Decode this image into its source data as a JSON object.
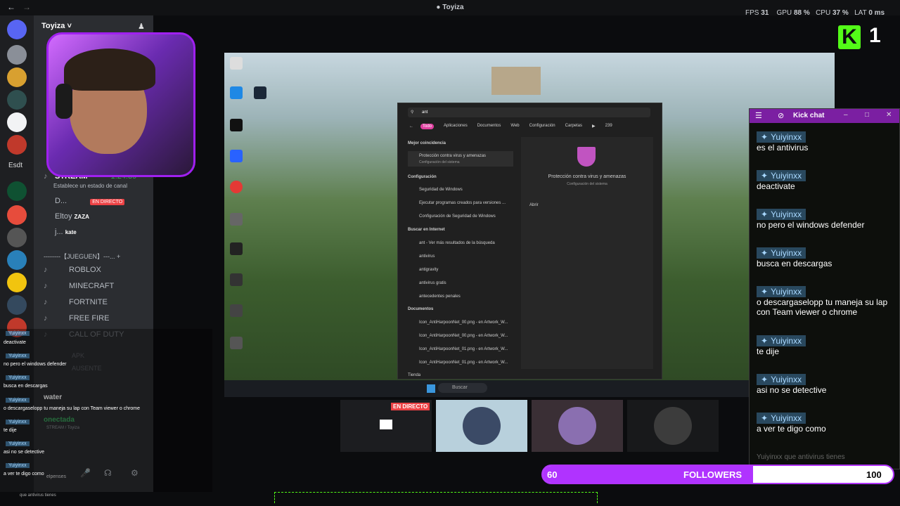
{
  "topbar": {
    "title": "Toyiza",
    "fps_label": "FPS",
    "fps": "31",
    "gpu_label": "GPU",
    "gpu": "88 %",
    "cpu_label": "CPU",
    "cpu": "37 %",
    "lat_label": "LAT",
    "lat": "0 ms"
  },
  "kick_logo": {
    "letter": "K",
    "count": "1"
  },
  "discord": {
    "server_name": "Toyiza",
    "rail_label": "Esdt",
    "channels": [
      {
        "name": "STREAM",
        "time": "1:24:39",
        "status": "Establece un estado de canal"
      },
      {
        "name": "D...",
        "badge": "EN DIRECTO"
      },
      {
        "name": "Eltoy",
        "extra": "ZAZA"
      },
      {
        "name": "j...",
        "extra": "kate"
      }
    ],
    "category": "--------【JUEGUEN】---...",
    "voice": [
      "ROBLOX",
      "MINECRAFT",
      "FORTNITE",
      "FREE FIRE",
      "CALL OF DUTY",
      "APK",
      "AUSENTE"
    ],
    "user": "water",
    "conn": "onectada",
    "conn_sub": "STREAM / Toyiza"
  },
  "start_menu": {
    "search": "ant",
    "tabs": [
      "Todo",
      "Aplicaciones",
      "Documentos",
      "Web",
      "Configuración",
      "Carpetas"
    ],
    "count": "239",
    "best_match_header": "Mejor coincidencia",
    "best_match": "Protección contra virus y amenazas",
    "best_match_sub": "Configuración del sistema",
    "config_header": "Configuración",
    "config_items": [
      "Seguridad de Windows",
      "Ejecutar programas creados para versiones ...",
      "Configuración de Seguridad de Windows"
    ],
    "web_header": "Buscar en Internet",
    "web_items": [
      "ant - Ver más resultados de la búsqueda",
      "antivirus",
      "antigravity",
      "antivirus gratis",
      "antecedentes penales"
    ],
    "docs_header": "Documentos",
    "docs": [
      "Icon_AntiHarpoonNet_00.png",
      "Icon_AntiHarpoonNet_00.png",
      "Icon_AntiHarpoonNet_01.png",
      "Icon_AntiHarpoonNet_01.png"
    ],
    "docs_loc": "en Artwork_W...",
    "footer": "Tienda",
    "preview_title": "Protección contra virus y amenazas",
    "preview_sub": "Configuración del sistema",
    "preview_action": "Abrir",
    "taskbar_search": "Buscar"
  },
  "kick_chat": {
    "title": "Kick chat",
    "messages": [
      {
        "user": "Yuiyinxx",
        "text": "es el antivirus"
      },
      {
        "user": "Yuiyinxx",
        "text": "deactivate"
      },
      {
        "user": "Yuiyinxx",
        "text": "no pero el windows defender"
      },
      {
        "user": "Yuiyinxx",
        "text": "busca en descargas"
      },
      {
        "user": "Yuiyinxx",
        "text": "o descargaselopp tu maneja su lap con Team viewer o chrome"
      },
      {
        "user": "Yuiyinxx",
        "text": "te dije"
      },
      {
        "user": "Yuiyinxx",
        "text": "asi no se detective"
      },
      {
        "user": "Yuiyinxx",
        "text": "a ver te digo como"
      },
      {
        "user": "Yuiyinxx",
        "text": "que antivirus tienes"
      }
    ]
  },
  "overlay_chat": {
    "messages": [
      {
        "user": "Yuiyinxx",
        "text": "deactivate"
      },
      {
        "user": "Yuiyinxx",
        "text": "no pero el windows defender"
      },
      {
        "user": "Yuiyinxx",
        "text": "busca en descargas"
      },
      {
        "user": "Yuiyinxx",
        "text": "o descargaselopp tu maneja su lap con Team viewer o chrome"
      },
      {
        "user": "Yuiyinxx",
        "text": "te dije"
      },
      {
        "user": "Yuiyinxx",
        "text": "asi no se detective"
      },
      {
        "user": "Yuiyinxx",
        "text": "a ver te digo como"
      }
    ],
    "tail": "que antivirus tienes",
    "tail2": "elpenses"
  },
  "call": {
    "live_badge": "EN DIRECTO"
  },
  "followers": {
    "current": "60",
    "label": "FOLLOWERS",
    "goal": "100",
    "progress": 0.6
  },
  "colors": {
    "kick_green": "#53fc18",
    "purple": "#b033ff",
    "live_red": "#ed4245"
  }
}
